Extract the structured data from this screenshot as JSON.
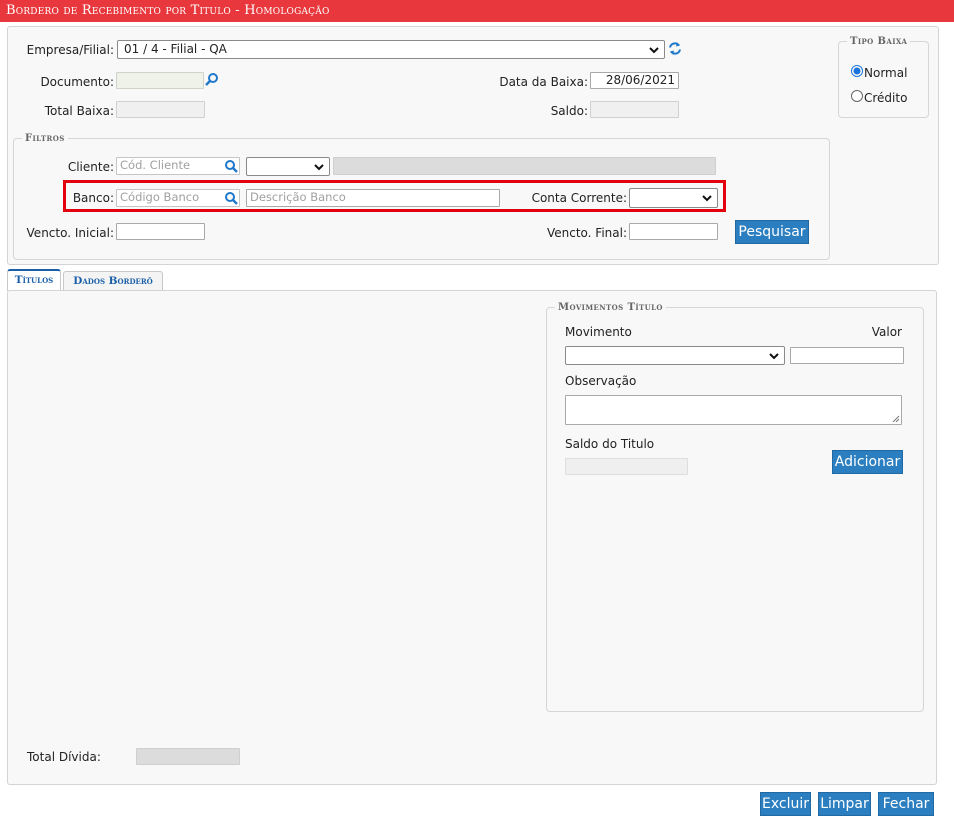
{
  "window": {
    "title": "Bordero de Recebimento por Titulo  - Homologação"
  },
  "header": {
    "empresa_label": "Empresa/Filial:",
    "empresa_value": "01 / 4 - Filial - QA",
    "documento_label": "Documento:",
    "data_baixa_label": "Data da Baixa:",
    "data_baixa_value": "28/06/2021",
    "total_baixa_label": "Total Baixa:",
    "saldo_label": "Saldo:"
  },
  "tipo_baixa": {
    "legend": "Tipo Baixa",
    "options": [
      {
        "label": "Normal",
        "selected": true
      },
      {
        "label": "Crédito",
        "selected": false
      }
    ]
  },
  "filtros": {
    "legend": "Filtros",
    "cliente_label": "Cliente:",
    "cliente_placeholder": "Cód. Cliente",
    "banco_label": "Banco:",
    "banco_placeholder": "Código Banco",
    "banco_desc_placeholder": "Descrição Banco",
    "conta_corrente_label": "Conta Corrente:",
    "vencto_inicial_label": "Vencto. Inicial:",
    "vencto_final_label": "Vencto. Final:",
    "pesquisar_label": "Pesquisar"
  },
  "tabs": [
    {
      "label": "Títulos",
      "active": true
    },
    {
      "label": "Dados Borderô",
      "active": false
    }
  ],
  "movimentos": {
    "legend": "Movimentos Título",
    "movimento_label": "Movimento",
    "valor_label": "Valor",
    "observacao_label": "Observação",
    "saldo_titulo_label": "Saldo do Titulo",
    "adicionar_label": "Adicionar"
  },
  "footer": {
    "total_divida_label": "Total Dívida:",
    "excluir_label": "Excluir",
    "limpar_label": "Limpar",
    "fechar_label": "Fechar"
  },
  "colors": {
    "title_bar": "#e8383d",
    "button": "#2b7fc0",
    "highlight_box": "#e3000f",
    "tab_text": "#1a5fa8"
  },
  "icons": {
    "search": "magnifier-icon",
    "refresh": "refresh-icon",
    "dropdown": "chevron-down-icon"
  }
}
